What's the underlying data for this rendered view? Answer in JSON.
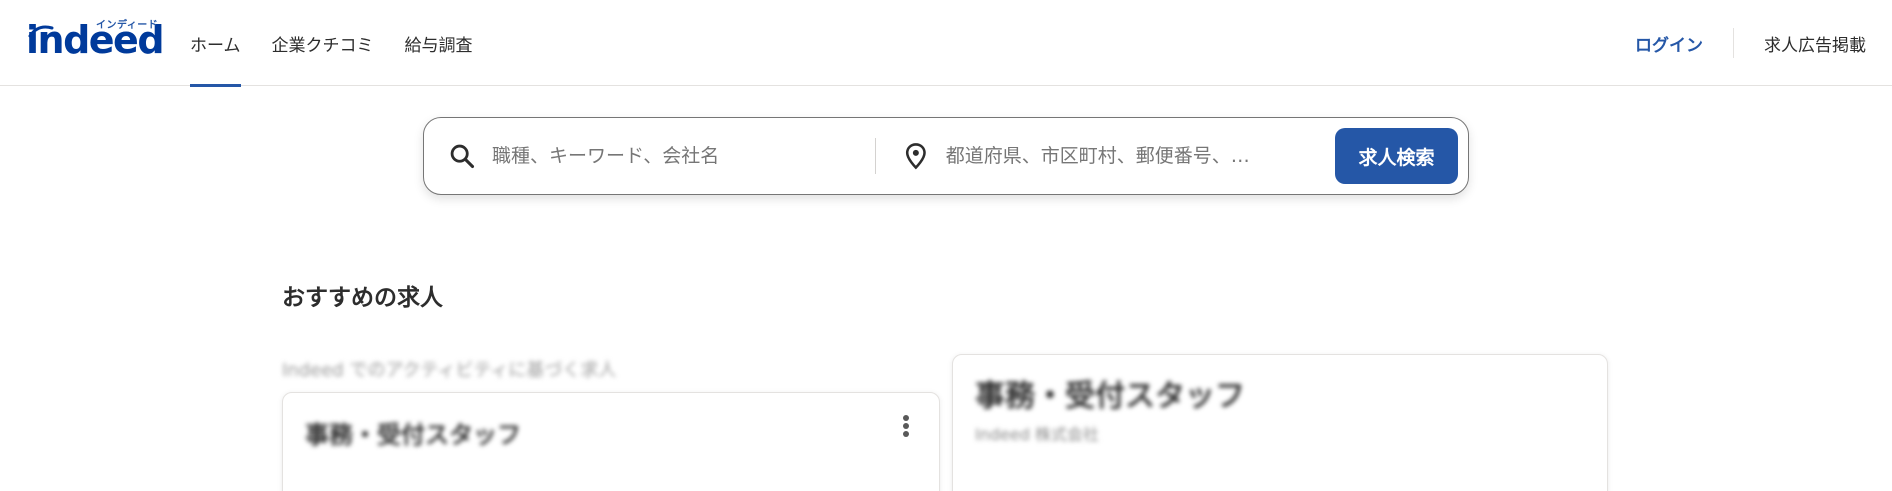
{
  "header": {
    "logo_text": "indeed",
    "logo_kana": "インディード",
    "nav": [
      {
        "label": "ホーム",
        "active": true
      },
      {
        "label": "企業クチコミ",
        "active": false
      },
      {
        "label": "給与調査",
        "active": false
      }
    ],
    "login_label": "ログイン",
    "employers_label": "求人広告掲載"
  },
  "search": {
    "what_placeholder": "職種、キーワード、会社名",
    "where_placeholder": "都道府県、市区町村、郵便番号、…",
    "what_icon": "search-icon",
    "where_icon": "location-pin-icon",
    "button_label": "求人検索"
  },
  "recommended": {
    "title": "おすすめの求人",
    "activity_note": "Indeed でのアクティビティに基づく求人",
    "cards": [
      {
        "title": "事務・受付スタッフ",
        "company": ""
      },
      {
        "title": "事務・受付スタッフ",
        "company": "Indeed 株式会社"
      }
    ]
  },
  "colors": {
    "brand_blue": "#2557a7",
    "logo_blue": "#003a9b",
    "text": "#2d2d2d",
    "border": "#e4e2e0"
  }
}
